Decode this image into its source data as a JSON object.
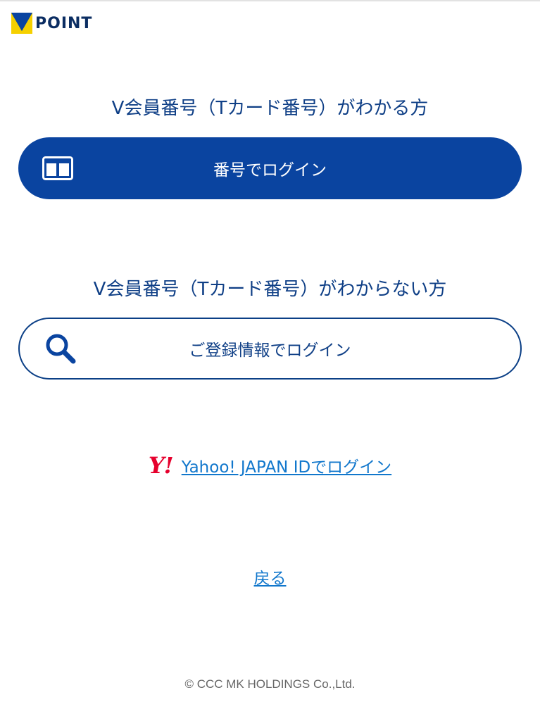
{
  "header": {
    "logo_text": "POINT"
  },
  "known_section": {
    "heading": "V会員番号（Tカード番号）がわかる方",
    "button_label": "番号でログイン",
    "icon": "card-icon"
  },
  "unknown_section": {
    "heading": "V会員番号（Tカード番号）がわからない方",
    "button_label": "ご登録情報でログイン",
    "icon": "search-icon"
  },
  "yahoo": {
    "logo_text": "Y!",
    "link_label": "Yahoo! JAPAN IDでログイン"
  },
  "back": {
    "label": "戻る"
  },
  "footer": {
    "copyright": "© CCC MK HOLDINGS Co.,Ltd."
  },
  "colors": {
    "brand_navy": "#0a44a0",
    "text_navy": "#0f3f86",
    "link_blue": "#1177cc",
    "yahoo_red": "#e6002d",
    "logo_yellow": "#f5d000"
  }
}
